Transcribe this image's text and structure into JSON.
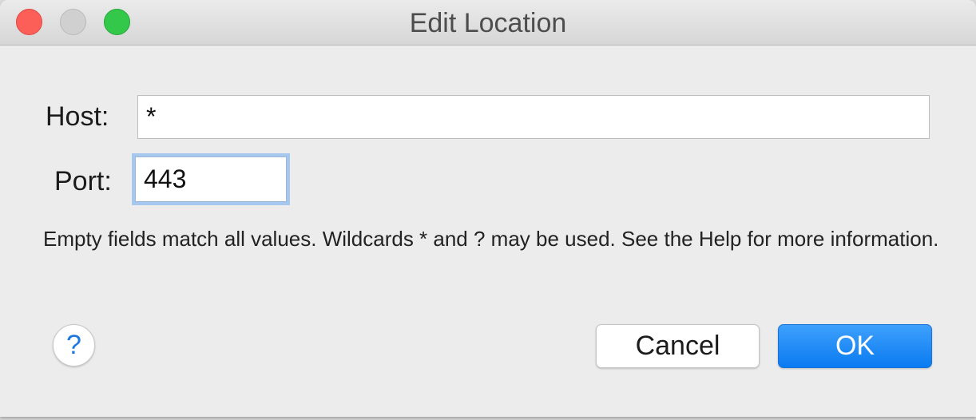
{
  "window": {
    "title": "Edit Location"
  },
  "form": {
    "host_label": "Host:",
    "host_value": "*",
    "port_label": "Port:",
    "port_value": "443",
    "info_text": "Empty fields match all values. Wildcards * and ? may be used. See the Help for more information."
  },
  "buttons": {
    "help_label": "?",
    "cancel_label": "Cancel",
    "ok_label": "OK"
  },
  "colors": {
    "accent": "#0a7bf1",
    "close": "#fc5f57",
    "zoom": "#34c84a",
    "focus_ring": "#a7c8ee"
  }
}
